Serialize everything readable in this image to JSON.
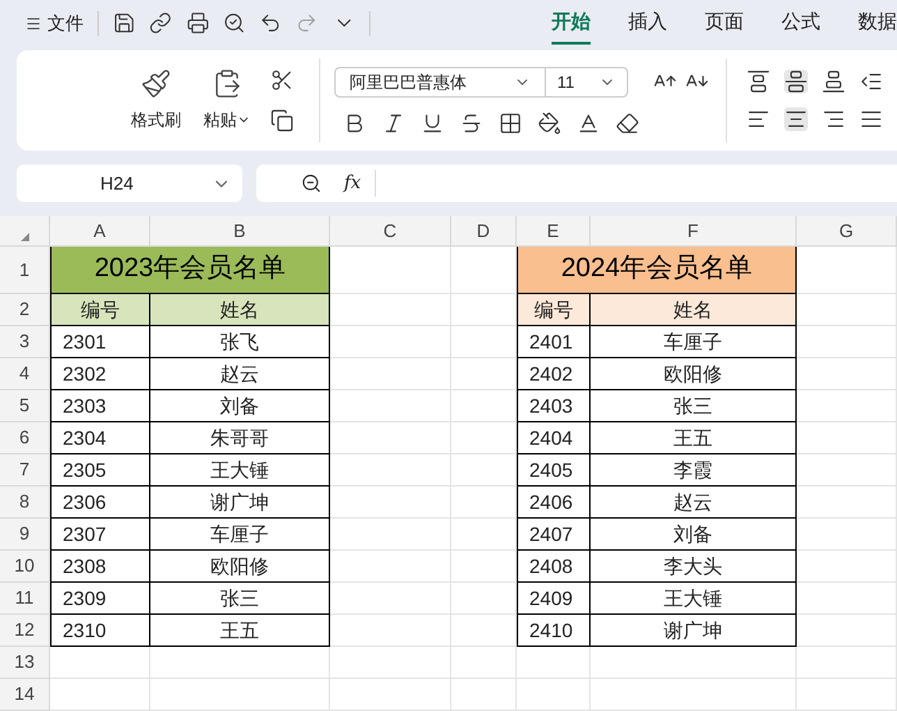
{
  "menu": {
    "label": "文件",
    "tabs": [
      {
        "label": "开始",
        "selected": true
      },
      {
        "label": "插入",
        "selected": false
      },
      {
        "label": "页面",
        "selected": false
      },
      {
        "label": "公式",
        "selected": false
      },
      {
        "label": "数据",
        "selected": false
      }
    ]
  },
  "ribbon": {
    "format_painter": "格式刷",
    "paste": "粘贴",
    "font": "阿里巴巴普惠体",
    "size": "11"
  },
  "formula_bar": {
    "cell_ref": "H24",
    "fx": "fx"
  },
  "sheet": {
    "columns": [
      "A",
      "B",
      "C",
      "D",
      "E",
      "F",
      "G"
    ],
    "row_numbers": [
      "1",
      "2",
      "3",
      "4",
      "5",
      "6",
      "7",
      "8",
      "9",
      "10",
      "11",
      "12",
      "13",
      "14"
    ],
    "tables": [
      {
        "title": "2023年会员名单",
        "color": "#9bbb59",
        "headers": [
          {
            "label": "编号",
            "color": "#d8e4bc"
          },
          {
            "label": "姓名",
            "color": "#d8e4bc"
          }
        ],
        "rows": [
          [
            "2301",
            "张飞"
          ],
          [
            "2302",
            "赵云"
          ],
          [
            "2303",
            "刘备"
          ],
          [
            "2304",
            "朱哥哥"
          ],
          [
            "2305",
            "王大锤"
          ],
          [
            "2306",
            "谢广坤"
          ],
          [
            "2307",
            "车厘子"
          ],
          [
            "2308",
            "欧阳修"
          ],
          [
            "2309",
            "张三"
          ],
          [
            "2310",
            "王五"
          ]
        ]
      },
      {
        "title": "2024年会员名单",
        "color": "#fabf8f",
        "headers": [
          {
            "label": "编号",
            "color": "#fde9d9"
          },
          {
            "label": "姓名",
            "color": "#fde9d9"
          }
        ],
        "rows": [
          [
            "2401",
            "车厘子"
          ],
          [
            "2402",
            "欧阳修"
          ],
          [
            "2403",
            "张三"
          ],
          [
            "2404",
            "王五"
          ],
          [
            "2405",
            "李霞"
          ],
          [
            "2406",
            "赵云"
          ],
          [
            "2407",
            "刘备"
          ],
          [
            "2408",
            "李大头"
          ],
          [
            "2409",
            "王大锤"
          ],
          [
            "2410",
            "谢广坤"
          ]
        ]
      }
    ]
  }
}
